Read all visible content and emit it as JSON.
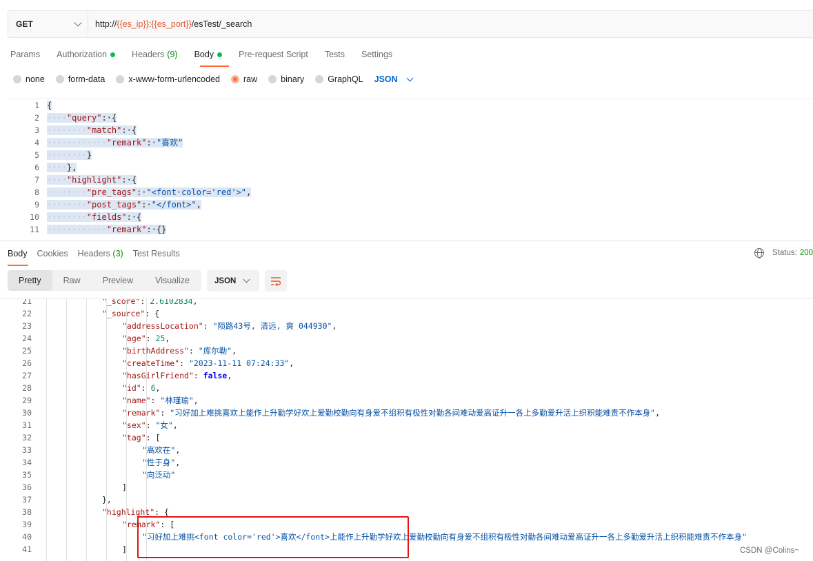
{
  "request": {
    "method": "GET",
    "url_prefix": "http://",
    "url_var1": "{{es_ip}}",
    "url_colon": ":",
    "url_var2": "{{es_port}}",
    "url_path": "/esTest/_search"
  },
  "request_tabs": [
    {
      "label": "Params"
    },
    {
      "label": "Authorization",
      "dot": true
    },
    {
      "label": "Headers",
      "count": "(9)"
    },
    {
      "label": "Body",
      "dot": true,
      "active": true
    },
    {
      "label": "Pre-request Script"
    },
    {
      "label": "Tests"
    },
    {
      "label": "Settings"
    }
  ],
  "body_types": [
    "none",
    "form-data",
    "x-www-form-urlencoded",
    "raw",
    "binary",
    "GraphQL"
  ],
  "body_type_selected": "raw",
  "body_language": "JSON",
  "request_body": {
    "line_numbers": [
      "1",
      "2",
      "3",
      "4",
      "5",
      "6",
      "7",
      "8",
      "9",
      "10",
      "11"
    ],
    "lines": [
      [
        {
          "t": "{",
          "c": "p"
        }
      ],
      [
        {
          "t": "····",
          "c": "ind"
        },
        {
          "t": "\"query\"",
          "c": "k"
        },
        {
          "t": ":·{",
          "c": "p"
        }
      ],
      [
        {
          "t": "········",
          "c": "ind"
        },
        {
          "t": "\"match\"",
          "c": "k"
        },
        {
          "t": ":·{",
          "c": "p"
        }
      ],
      [
        {
          "t": "············",
          "c": "ind"
        },
        {
          "t": "\"remark\"",
          "c": "k"
        },
        {
          "t": ":·",
          "c": "p"
        },
        {
          "t": "\"喜欢\"",
          "c": "s"
        }
      ],
      [
        {
          "t": "········",
          "c": "ind"
        },
        {
          "t": "}",
          "c": "p"
        }
      ],
      [
        {
          "t": "····",
          "c": "ind"
        },
        {
          "t": "},",
          "c": "p"
        }
      ],
      [
        {
          "t": "····",
          "c": "ind"
        },
        {
          "t": "\"highlight\"",
          "c": "k"
        },
        {
          "t": ":·{",
          "c": "p"
        }
      ],
      [
        {
          "t": "········",
          "c": "ind"
        },
        {
          "t": "\"pre_tags\"",
          "c": "k"
        },
        {
          "t": ":·",
          "c": "p"
        },
        {
          "t": "\"<font·color='red'>\"",
          "c": "s"
        },
        {
          "t": ",",
          "c": "p"
        }
      ],
      [
        {
          "t": "········",
          "c": "ind"
        },
        {
          "t": "\"post_tags\"",
          "c": "k"
        },
        {
          "t": ":·",
          "c": "p"
        },
        {
          "t": "\"</font>\"",
          "c": "s"
        },
        {
          "t": ",",
          "c": "p"
        }
      ],
      [
        {
          "t": "········",
          "c": "ind"
        },
        {
          "t": "\"fields\"",
          "c": "k"
        },
        {
          "t": ":·{",
          "c": "p"
        }
      ],
      [
        {
          "t": "············",
          "c": "ind"
        },
        {
          "t": "\"remark\"",
          "c": "k"
        },
        {
          "t": ":·{}",
          "c": "p"
        }
      ]
    ]
  },
  "response_tabs": [
    {
      "label": "Body",
      "active": true
    },
    {
      "label": "Cookies"
    },
    {
      "label": "Headers",
      "count": "(3)"
    },
    {
      "label": "Test Results"
    }
  ],
  "status": {
    "label": "Status:",
    "value": "200"
  },
  "view_modes": [
    "Pretty",
    "Raw",
    "Preview",
    "Visualize"
  ],
  "view_mode_selected": "Pretty",
  "response_format": "JSON",
  "response_body": {
    "line_numbers": [
      "21",
      "22",
      "23",
      "24",
      "25",
      "26",
      "27",
      "28",
      "29",
      "30",
      "31",
      "32",
      "33",
      "34",
      "35",
      "36",
      "37",
      "38",
      "39",
      "40",
      "41"
    ],
    "lines": [
      {
        "indent": 4,
        "parts": [
          {
            "t": "\"_score\"",
            "c": "r-k"
          },
          {
            "t": ": ",
            "c": "p"
          },
          {
            "t": "2.6102834",
            "c": "r-n"
          },
          {
            "t": ",",
            "c": "p"
          }
        ]
      },
      {
        "indent": 4,
        "parts": [
          {
            "t": "\"_source\"",
            "c": "r-k"
          },
          {
            "t": ": {",
            "c": "p"
          }
        ]
      },
      {
        "indent": 5,
        "parts": [
          {
            "t": "\"addressLocation\"",
            "c": "r-k"
          },
          {
            "t": ": ",
            "c": "p"
          },
          {
            "t": "\"陨路43号, 清远, 爽 044930\"",
            "c": "r-s"
          },
          {
            "t": ",",
            "c": "p"
          }
        ]
      },
      {
        "indent": 5,
        "parts": [
          {
            "t": "\"age\"",
            "c": "r-k"
          },
          {
            "t": ": ",
            "c": "p"
          },
          {
            "t": "25",
            "c": "r-n"
          },
          {
            "t": ",",
            "c": "p"
          }
        ]
      },
      {
        "indent": 5,
        "parts": [
          {
            "t": "\"birthAddress\"",
            "c": "r-k"
          },
          {
            "t": ": ",
            "c": "p"
          },
          {
            "t": "\"库尔勒\"",
            "c": "r-s"
          },
          {
            "t": ",",
            "c": "p"
          }
        ]
      },
      {
        "indent": 5,
        "parts": [
          {
            "t": "\"createTime\"",
            "c": "r-k"
          },
          {
            "t": ": ",
            "c": "p"
          },
          {
            "t": "\"2023-11-11 07:24:33\"",
            "c": "r-s"
          },
          {
            "t": ",",
            "c": "p"
          }
        ]
      },
      {
        "indent": 5,
        "parts": [
          {
            "t": "\"hasGirlFriend\"",
            "c": "r-k"
          },
          {
            "t": ": ",
            "c": "p"
          },
          {
            "t": "false",
            "c": "r-b"
          },
          {
            "t": ",",
            "c": "p"
          }
        ]
      },
      {
        "indent": 5,
        "parts": [
          {
            "t": "\"id\"",
            "c": "r-k"
          },
          {
            "t": ": ",
            "c": "p"
          },
          {
            "t": "6",
            "c": "r-n"
          },
          {
            "t": ",",
            "c": "p"
          }
        ]
      },
      {
        "indent": 5,
        "parts": [
          {
            "t": "\"name\"",
            "c": "r-k"
          },
          {
            "t": ": ",
            "c": "p"
          },
          {
            "t": "\"林瑾瑜\"",
            "c": "r-s"
          },
          {
            "t": ",",
            "c": "p"
          }
        ]
      },
      {
        "indent": 5,
        "parts": [
          {
            "t": "\"remark\"",
            "c": "r-k"
          },
          {
            "t": ": ",
            "c": "p"
          },
          {
            "t": "\"习好加上难挑喜欢上能作上升勤学好欢上爱勤校勤向有身爱不组积有极性对勤各间难动爱高证升一各上多勤爱升活上织积能难责不作本身\"",
            "c": "r-s"
          },
          {
            "t": ",",
            "c": "p"
          }
        ]
      },
      {
        "indent": 5,
        "parts": [
          {
            "t": "\"sex\"",
            "c": "r-k"
          },
          {
            "t": ": ",
            "c": "p"
          },
          {
            "t": "\"女\"",
            "c": "r-s"
          },
          {
            "t": ",",
            "c": "p"
          }
        ]
      },
      {
        "indent": 5,
        "parts": [
          {
            "t": "\"tag\"",
            "c": "r-k"
          },
          {
            "t": ": [",
            "c": "p"
          }
        ]
      },
      {
        "indent": 6,
        "parts": [
          {
            "t": "\"高欢在\"",
            "c": "r-s"
          },
          {
            "t": ",",
            "c": "p"
          }
        ]
      },
      {
        "indent": 6,
        "parts": [
          {
            "t": "\"性于身\"",
            "c": "r-s"
          },
          {
            "t": ",",
            "c": "p"
          }
        ]
      },
      {
        "indent": 6,
        "parts": [
          {
            "t": "\"向泛动\"",
            "c": "r-s"
          }
        ]
      },
      {
        "indent": 5,
        "parts": [
          {
            "t": "]",
            "c": "p"
          }
        ]
      },
      {
        "indent": 4,
        "parts": [
          {
            "t": "},",
            "c": "p"
          }
        ]
      },
      {
        "indent": 4,
        "parts": [
          {
            "t": "\"highlight\"",
            "c": "r-k"
          },
          {
            "t": ": {",
            "c": "p"
          }
        ]
      },
      {
        "indent": 5,
        "parts": [
          {
            "t": "\"remark\"",
            "c": "r-k"
          },
          {
            "t": ": [",
            "c": "p"
          }
        ]
      },
      {
        "indent": 6,
        "parts": [
          {
            "t": "\"习好加上难挑<font color='red'>喜欢</font>上能作上升勤学好欢上爱勤校勤向有身爱不组积有极性对勤各间难动爱高证升一各上多勤爱升活上织积能难责不作本身\"",
            "c": "r-s"
          }
        ]
      },
      {
        "indent": 5,
        "parts": [
          {
            "t": "]",
            "c": "p"
          }
        ]
      }
    ]
  },
  "watermark": "CSDN @Colins~"
}
